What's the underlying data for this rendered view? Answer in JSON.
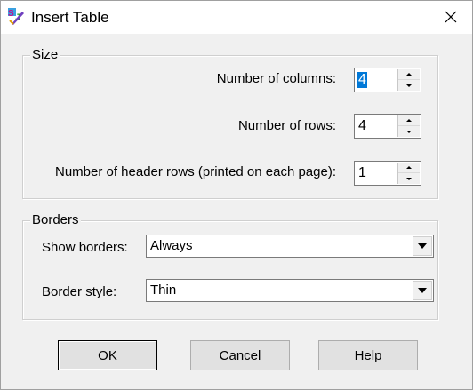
{
  "window": {
    "title": "Insert Table"
  },
  "size_group": {
    "label": "Size",
    "columns": {
      "label": "Number of columns:",
      "value": "4",
      "selected": true
    },
    "rows": {
      "label": "Number of rows:",
      "value": "4"
    },
    "header_rows": {
      "label": "Number of header rows (printed on each page):",
      "value": "1"
    }
  },
  "borders_group": {
    "label": "Borders",
    "show_borders": {
      "label": "Show borders:",
      "value": "Always"
    },
    "border_style": {
      "label": "Border style:",
      "value": "Thin"
    }
  },
  "buttons": {
    "ok": "OK",
    "cancel": "Cancel",
    "help": "Help"
  },
  "icons": {
    "app": "app-icon",
    "close": "close-icon",
    "spin_up": "spin-up-arrow-icon",
    "spin_down": "spin-down-arrow-icon",
    "dropdown": "chevron-down-icon"
  }
}
